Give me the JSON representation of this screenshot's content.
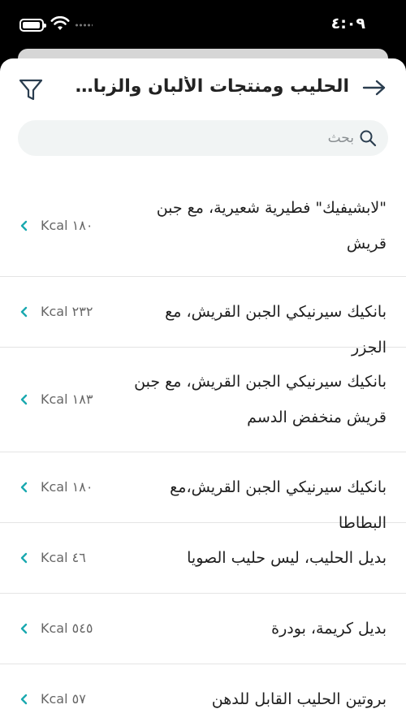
{
  "status": {
    "time": "٤:٠٩"
  },
  "header": {
    "title": "الحليب ومنتجات الألبان والزبادي والزبدة"
  },
  "search": {
    "placeholder": "بحث",
    "value": ""
  },
  "colors": {
    "accent": "#1aa9b0",
    "title": "#222222",
    "icon": "#2a3d4f"
  },
  "items": [
    {
      "name": "\"لابشيفيك\" فطيرية شعيرية، مع جبن قريش",
      "kcal": "Kcal ١٨٠"
    },
    {
      "name": "بانكيك سيرنيكي الجبن القريش، مع الجزر",
      "kcal": "Kcal ٢٣٢"
    },
    {
      "name": "بانكيك سيرنيكي الجبن القريش، مع جبن قريش منخفض الدسم",
      "kcal": "Kcal ١٨٣"
    },
    {
      "name": "بانكيك سيرنيكي الجبن القريش،مع البطاطا",
      "kcal": "Kcal ١٨٠"
    },
    {
      "name": "بديل الحليب، ليس حليب الصويا",
      "kcal": "Kcal ٤٦"
    },
    {
      "name": "بديل كريمة، بودرة",
      "kcal": "Kcal ٥٤٥"
    },
    {
      "name": "بروتين الحليب القابل للدهن",
      "kcal": "Kcal ٥٧"
    }
  ]
}
